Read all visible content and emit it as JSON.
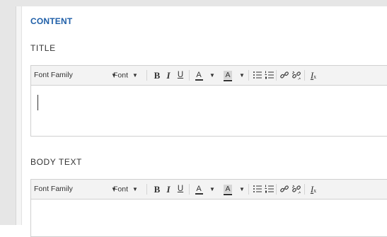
{
  "section": {
    "title": "CONTENT"
  },
  "fields": {
    "title": {
      "label": "TITLE"
    },
    "body": {
      "label": "BODY TEXT"
    }
  },
  "toolbar": {
    "font_family": "Font Family",
    "font_size": "Font",
    "bold": "B",
    "italic": "I",
    "underline": "U",
    "text_color": "A",
    "background_color": "A",
    "icons": [
      "bullet-list-icon",
      "numbered-list-icon",
      "link-icon",
      "unlink-icon",
      "clear-formatting-icon"
    ],
    "caret": "▼",
    "clear_format_glyph": "I",
    "clear_format_sub": "x"
  },
  "colors": {
    "section_title": "#1f5fa8",
    "toolbar_bg": "#f3f3f3",
    "border": "#d0d0d0"
  }
}
